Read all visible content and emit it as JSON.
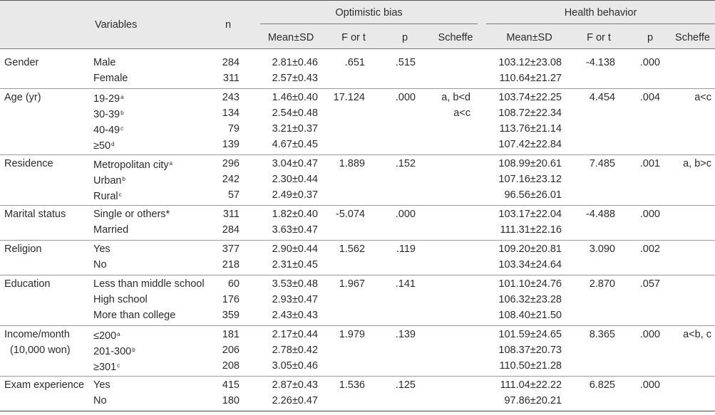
{
  "header": {
    "variables": "Variables",
    "n": "n",
    "group_optimistic": "Optimistic bias",
    "group_health": "Health behavior",
    "mean_sd": "Mean±SD",
    "f_or_t": "F or t",
    "p": "p",
    "scheffe": "Scheffe"
  },
  "groups": [
    {
      "label": [
        "Gender"
      ],
      "rows": [
        {
          "cat": "Male",
          "sup": "",
          "n": "284",
          "ob_mean": "2.81±0.46",
          "ob_f": ".651",
          "ob_p": ".515",
          "ob_s": [],
          "hb_mean": "103.12±23.08",
          "hb_f": "-4.138",
          "hb_p": ".000",
          "hb_s": ""
        },
        {
          "cat": "Female",
          "sup": "",
          "n": "311",
          "ob_mean": "2.57±0.43",
          "ob_f": "",
          "ob_p": "",
          "ob_s": [],
          "hb_mean": "110.64±21.27",
          "hb_f": "",
          "hb_p": "",
          "hb_s": ""
        }
      ]
    },
    {
      "label": [
        "Age (yr)"
      ],
      "rows": [
        {
          "cat": "19-29",
          "sup": "a",
          "n": "243",
          "ob_mean": "1.46±0.40",
          "ob_f": "17.124",
          "ob_p": ".000",
          "ob_s": [
            "a, b<d",
            "a<c"
          ],
          "hb_mean": "103.74±22.25",
          "hb_f": "4.454",
          "hb_p": ".004",
          "hb_s": "a<c"
        },
        {
          "cat": "30-39",
          "sup": "b",
          "n": "134",
          "ob_mean": "2.54±0.48",
          "ob_f": "",
          "ob_p": "",
          "ob_s": [],
          "hb_mean": "108.72±22.34",
          "hb_f": "",
          "hb_p": "",
          "hb_s": ""
        },
        {
          "cat": "40-49",
          "sup": "c",
          "n": "79",
          "ob_mean": "3.21±0.37",
          "ob_f": "",
          "ob_p": "",
          "ob_s": [],
          "hb_mean": "113.76±21.14",
          "hb_f": "",
          "hb_p": "",
          "hb_s": ""
        },
        {
          "cat": "≥50",
          "sup": "d",
          "n": "139",
          "ob_mean": "4.67±0.45",
          "ob_f": "",
          "ob_p": "",
          "ob_s": [],
          "hb_mean": "107.42±22.84",
          "hb_f": "",
          "hb_p": "",
          "hb_s": ""
        }
      ]
    },
    {
      "label": [
        "Residence"
      ],
      "rows": [
        {
          "cat": "Metropolitan city",
          "sup": "a",
          "n": "296",
          "ob_mean": "3.04±0.47",
          "ob_f": "1.889",
          "ob_p": ".152",
          "ob_s": [],
          "hb_mean": "108.99±20.61",
          "hb_f": "7.485",
          "hb_p": ".001",
          "hb_s": "a, b>c"
        },
        {
          "cat": "Urban",
          "sup": "b",
          "n": "242",
          "ob_mean": "2.30±0.44",
          "ob_f": "",
          "ob_p": "",
          "ob_s": [],
          "hb_mean": "107.16±23.12",
          "hb_f": "",
          "hb_p": "",
          "hb_s": ""
        },
        {
          "cat": "Rural",
          "sup": "c",
          "n": "57",
          "ob_mean": "2.49±0.37",
          "ob_f": "",
          "ob_p": "",
          "ob_s": [],
          "hb_mean": "96.56±26.01",
          "hb_f": "",
          "hb_p": "",
          "hb_s": ""
        }
      ]
    },
    {
      "label": [
        "Marital status"
      ],
      "rows": [
        {
          "cat": "Single or others*",
          "sup": "",
          "n": "311",
          "ob_mean": "1.82±0.40",
          "ob_f": "-5.074",
          "ob_p": ".000",
          "ob_s": [],
          "hb_mean": "103.17±22.04",
          "hb_f": "-4.488",
          "hb_p": ".000",
          "hb_s": ""
        },
        {
          "cat": "Married",
          "sup": "",
          "n": "284",
          "ob_mean": "3.63±0.47",
          "ob_f": "",
          "ob_p": "",
          "ob_s": [],
          "hb_mean": "111.31±22.16",
          "hb_f": "",
          "hb_p": "",
          "hb_s": ""
        }
      ]
    },
    {
      "label": [
        "Religion"
      ],
      "rows": [
        {
          "cat": "Yes",
          "sup": "",
          "n": "377",
          "ob_mean": "2.90±0.44",
          "ob_f": "1.562",
          "ob_p": ".119",
          "ob_s": [],
          "hb_mean": "109.20±20.81",
          "hb_f": "3.090",
          "hb_p": ".002",
          "hb_s": ""
        },
        {
          "cat": "No",
          "sup": "",
          "n": "218",
          "ob_mean": "2.31±0.45",
          "ob_f": "",
          "ob_p": "",
          "ob_s": [],
          "hb_mean": "103.34±24.64",
          "hb_f": "",
          "hb_p": "",
          "hb_s": ""
        }
      ]
    },
    {
      "label": [
        "Education"
      ],
      "rows": [
        {
          "cat": "Less than middle school",
          "sup": "",
          "n": "60",
          "ob_mean": "3.53±0.48",
          "ob_f": "1.967",
          "ob_p": ".141",
          "ob_s": [],
          "hb_mean": "101.10±24.76",
          "hb_f": "2.870",
          "hb_p": ".057",
          "hb_s": ""
        },
        {
          "cat": "High school",
          "sup": "",
          "n": "176",
          "ob_mean": "2.93±0.47",
          "ob_f": "",
          "ob_p": "",
          "ob_s": [],
          "hb_mean": "106.32±23.28",
          "hb_f": "",
          "hb_p": "",
          "hb_s": ""
        },
        {
          "cat": "More than college",
          "sup": "",
          "n": "359",
          "ob_mean": "2.43±0.43",
          "ob_f": "",
          "ob_p": "",
          "ob_s": [],
          "hb_mean": "108.40±21.50",
          "hb_f": "",
          "hb_p": "",
          "hb_s": ""
        }
      ]
    },
    {
      "label": [
        "Income/month",
        "(10,000 won)"
      ],
      "rows": [
        {
          "cat": "≤200",
          "sup": "a",
          "n": "181",
          "ob_mean": "2.17±0.44",
          "ob_f": "1.979",
          "ob_p": ".139",
          "ob_s": [],
          "hb_mean": "101.59±24.65",
          "hb_f": "8.365",
          "hb_p": ".000",
          "hb_s": "a<b, c"
        },
        {
          "cat": "201-300",
          "sup": "b",
          "n": "206",
          "ob_mean": "2.78±0.42",
          "ob_f": "",
          "ob_p": "",
          "ob_s": [],
          "hb_mean": "108.37±20.73",
          "hb_f": "",
          "hb_p": "",
          "hb_s": ""
        },
        {
          "cat": "≥301",
          "sup": "c",
          "n": "208",
          "ob_mean": "3.05±0.46",
          "ob_f": "",
          "ob_p": "",
          "ob_s": [],
          "hb_mean": "110.50±21.28",
          "hb_f": "",
          "hb_p": "",
          "hb_s": ""
        }
      ]
    },
    {
      "label": [
        "Exam experience"
      ],
      "rows": [
        {
          "cat": "Yes",
          "sup": "",
          "n": "415",
          "ob_mean": "2.87±0.43",
          "ob_f": "1.536",
          "ob_p": ".125",
          "ob_s": [],
          "hb_mean": "111.04±22.22",
          "hb_f": "6.825",
          "hb_p": ".000",
          "hb_s": ""
        },
        {
          "cat": "No",
          "sup": "",
          "n": "180",
          "ob_mean": "2.26±0.47",
          "ob_f": "",
          "ob_p": "",
          "ob_s": [],
          "hb_mean": "97.86±20.21",
          "hb_f": "",
          "hb_p": "",
          "hb_s": ""
        }
      ]
    }
  ]
}
